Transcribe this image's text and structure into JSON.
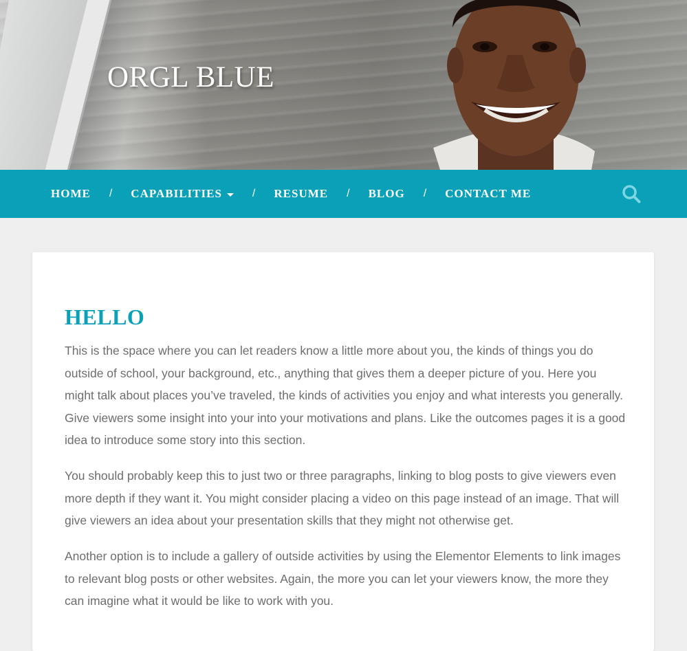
{
  "site": {
    "title": "ORGL BLUE"
  },
  "nav": {
    "items": [
      {
        "label": "HOME"
      },
      {
        "label": "CAPABILITIES",
        "has_dropdown": true
      },
      {
        "label": "RESUME"
      },
      {
        "label": "BLOG"
      },
      {
        "label": "CONTACT ME"
      }
    ],
    "separator": "/",
    "search_icon": "search-icon"
  },
  "content": {
    "heading": "HELLO",
    "paragraphs": [
      "This is the space where you can let readers know a little more about you, the kinds of things you do outside of school, your background, etc., anything that gives them a deeper picture of you. Here you might talk about places you’ve traveled, the kinds of activities you enjoy and what interests you generally. Give viewers some insight into your into your motivations and plans. Like the outcomes pages it is a good idea to introduce some story into this section.",
      "You should probably keep this to just two or three paragraphs, linking to blog posts to give viewers even more depth if they want it. You might consider placing a video on this page instead of an image. That will give viewers an idea about your presentation skills that they might not otherwise get.",
      "Another option is to include a gallery of outside activities by using the Elementor Elements to link images to relevant blog posts or other websites. Again, the more you can let your viewers know, the more they can imagine what it would be like to work with you."
    ]
  },
  "colors": {
    "accent": "#0aa0b8",
    "body_text": "#6d6d6d",
    "page_bg": "#efefef"
  }
}
